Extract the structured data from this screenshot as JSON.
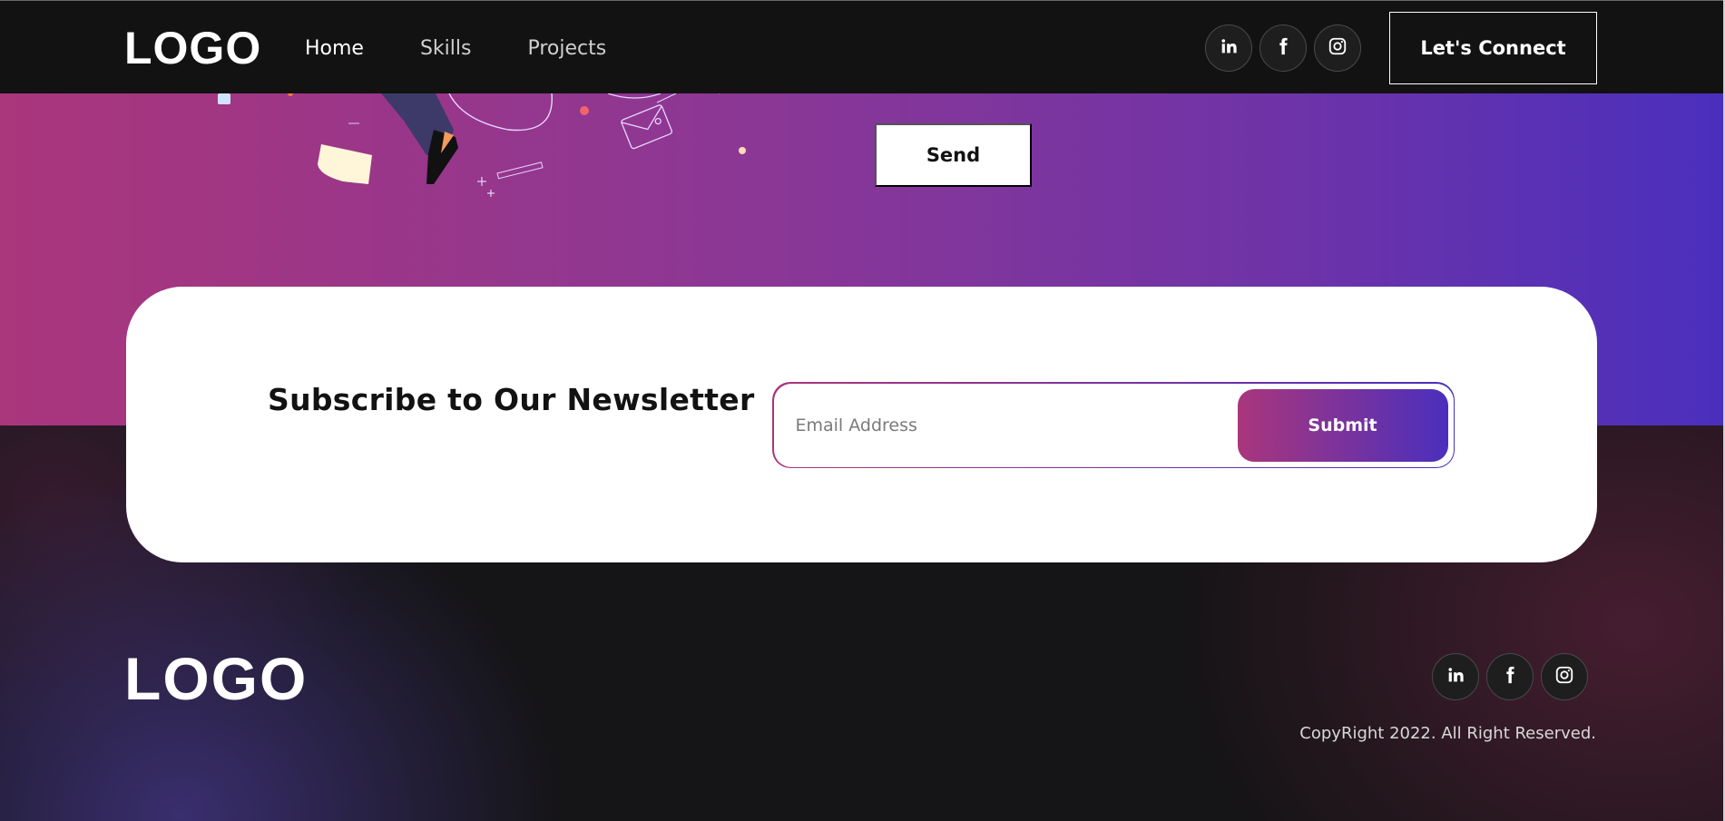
{
  "nav": {
    "logo": "LOGO",
    "links": [
      {
        "label": "Home",
        "active": true
      },
      {
        "label": "Skills",
        "active": false
      },
      {
        "label": "Projects",
        "active": false
      }
    ],
    "social": [
      {
        "name": "linkedin-icon",
        "label": "in"
      },
      {
        "name": "facebook-icon",
        "label": "f"
      },
      {
        "name": "instagram-icon",
        "label": ""
      }
    ],
    "connect_label": "Let's Connect"
  },
  "contact": {
    "send_label": "Send"
  },
  "newsletter": {
    "title": "Subscribe to Our Newsletter",
    "email_placeholder": "Email Address",
    "submit_label": "Submit"
  },
  "footer": {
    "logo": "LOGO",
    "copyright": "CopyRight 2022. All Right Reserved."
  },
  "colors": {
    "gradient_start": "#aa367c",
    "gradient_end": "#4a2fbd",
    "background_dark": "#121212",
    "text_light": "#ffffff"
  }
}
